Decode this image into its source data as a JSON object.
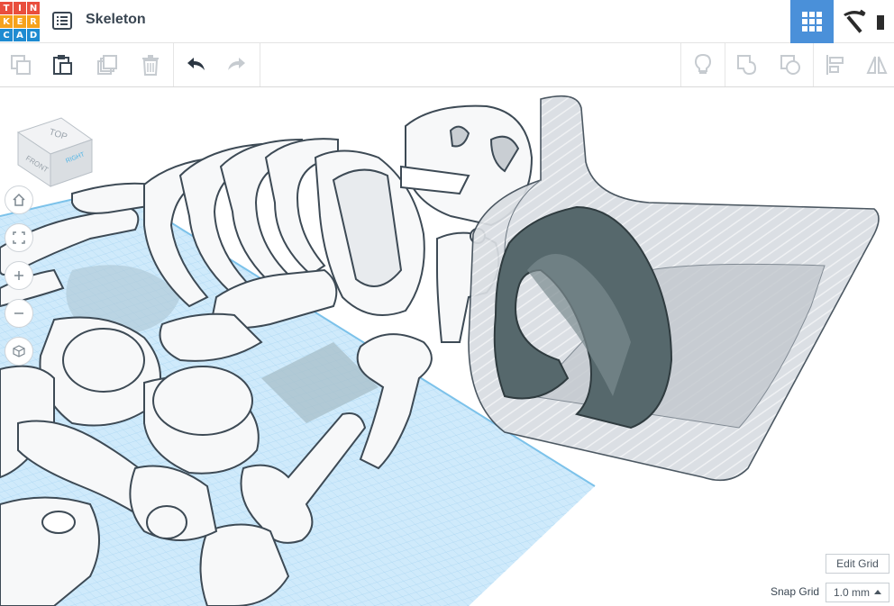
{
  "app": {
    "logo_letters": [
      "T",
      "I",
      "N",
      "K",
      "E",
      "R",
      "C",
      "A",
      "D"
    ],
    "logo_colors": [
      "#e94e3d",
      "#e94e3d",
      "#e94e3d",
      "#f6a21c",
      "#f6a21c",
      "#f6a21c",
      "#1f8bd1",
      "#1f8bd1",
      "#1f8bd1"
    ],
    "title": "Skeleton",
    "accent": "#4a90d9"
  },
  "header": {
    "design_list_icon": "list-icon",
    "grid_view_icon": "grid-view-icon",
    "minecraft_icon": "pickaxe-icon"
  },
  "toolbar": {
    "left": [
      "copy-icon",
      "paste-icon",
      "duplicate-icon",
      "delete-icon",
      "undo-icon",
      "redo-icon"
    ],
    "right": [
      "light-bulb-icon",
      "group-icon",
      "ungroup-icon",
      "align-icon",
      "mirror-icon"
    ]
  },
  "viewcube": {
    "top": "TOP",
    "front": "FRONT",
    "right": "RIGHT"
  },
  "nav_controls": [
    "home-view-icon",
    "fit-view-icon",
    "zoom-in-icon",
    "zoom-out-icon",
    "perspective-icon"
  ],
  "grid": {
    "edit_label": "Edit Grid",
    "snap_label": "Snap Grid",
    "snap_value": "1.0 mm"
  }
}
